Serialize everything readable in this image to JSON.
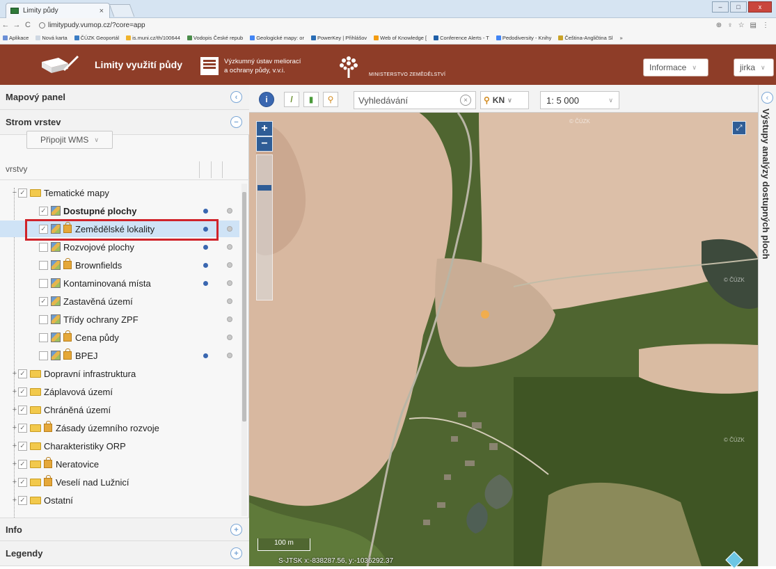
{
  "browser": {
    "tab_title": "Limity půdy",
    "tab_close": "×",
    "url": "limitypudy.vumop.cz/?core=app",
    "window_buttons": [
      "–",
      "□",
      "x"
    ],
    "nav": [
      "←",
      "→",
      "C"
    ],
    "addr_icons": [
      "⊕",
      "♀",
      "☆",
      "▤",
      "⋮"
    ],
    "bookmarks": [
      {
        "label": "Aplikace",
        "color": "#6b8fd6"
      },
      {
        "label": "Nová karta",
        "color": "#cfd8e3"
      },
      {
        "label": "ČÚZK Geoportál",
        "color": "#3c7dc4"
      },
      {
        "label": "is.muni.cz/th/100644",
        "color": "#f0b32c"
      },
      {
        "label": "Vodopis České repub",
        "color": "#4a8c4a"
      },
      {
        "label": "Geologické mapy: or",
        "color": "#4285f4"
      },
      {
        "label": "PowerKey | Přihlášov",
        "color": "#2a6db5"
      },
      {
        "label": "Web of Knowledge [",
        "color": "#f39c12"
      },
      {
        "label": "Conference Alerts - T",
        "color": "#1f5fa8"
      },
      {
        "label": "Pedodiversity - Knihy",
        "color": "#4285f4"
      },
      {
        "label": "Čeština-Angličtina Sl",
        "color": "#c9a227"
      },
      {
        "label": "»",
        "color": "#f6f6f6"
      }
    ]
  },
  "header": {
    "app_title": "Limity využití půdy",
    "vumop_line1": "Výzkumný ústav meliorací",
    "vumop_line2": "a ochrany půdy, v.v.i.",
    "ministry": "MINISTERSTVO ZEMĚDĚLSTVÍ",
    "info_select": "Informace",
    "user_select": "jirka",
    "brand_color": "#8e3d28"
  },
  "left_panel": {
    "map_panel_title": "Mapový panel",
    "layer_tree_title": "Strom vrstev",
    "wms_button": "Připojit WMS",
    "layers_label": "vrstvy",
    "info_title": "Info",
    "legend_title": "Legendy",
    "collapse_symbol": "‹",
    "minus_symbol": "−",
    "plus_symbol": "+"
  },
  "tree": [
    {
      "label": "Tematické mapy",
      "type": "folder",
      "expander": "−",
      "checked": true,
      "bold": false,
      "lock": false,
      "info": false,
      "depth": 0
    },
    {
      "label": "Dostupné plochy",
      "type": "layer",
      "checked": true,
      "bold": true,
      "lock": false,
      "info": true,
      "depth": 1
    },
    {
      "label": "Zemědělské lokality",
      "type": "layer",
      "checked": true,
      "bold": false,
      "lock": true,
      "info": true,
      "depth": 1,
      "selected": true
    },
    {
      "label": "Rozvojové plochy",
      "type": "layer",
      "checked": false,
      "bold": false,
      "lock": false,
      "info": true,
      "depth": 1
    },
    {
      "label": "Brownfields",
      "type": "layer",
      "checked": false,
      "bold": false,
      "lock": true,
      "info": true,
      "depth": 1
    },
    {
      "label": "Kontaminovaná místa",
      "type": "layer",
      "checked": false,
      "bold": false,
      "lock": false,
      "info": true,
      "depth": 1
    },
    {
      "label": "Zastavěná území",
      "type": "layer",
      "checked": true,
      "bold": false,
      "lock": false,
      "info": false,
      "depth": 1
    },
    {
      "label": "Třídy ochrany ZPF",
      "type": "layer",
      "checked": false,
      "bold": false,
      "lock": false,
      "info": false,
      "depth": 1
    },
    {
      "label": "Cena půdy",
      "type": "layer",
      "checked": false,
      "bold": false,
      "lock": true,
      "info": false,
      "depth": 1
    },
    {
      "label": "BPEJ",
      "type": "layer",
      "checked": false,
      "bold": false,
      "lock": true,
      "info": true,
      "depth": 1
    },
    {
      "label": "Dopravní infrastruktura",
      "type": "folder",
      "expander": "+",
      "checked": true,
      "bold": false,
      "lock": false,
      "info": false,
      "depth": 0
    },
    {
      "label": "Záplavová území",
      "type": "folder",
      "expander": "+",
      "checked": true,
      "bold": false,
      "lock": false,
      "info": false,
      "depth": 0
    },
    {
      "label": "Chráněná území",
      "type": "folder",
      "expander": "+",
      "checked": true,
      "bold": false,
      "lock": false,
      "info": false,
      "depth": 0
    },
    {
      "label": "Zásady územního rozvoje",
      "type": "folder",
      "expander": "+",
      "checked": true,
      "bold": false,
      "lock": true,
      "info": false,
      "depth": 0
    },
    {
      "label": "Charakteristiky ORP",
      "type": "folder",
      "expander": "+",
      "checked": true,
      "bold": false,
      "lock": false,
      "info": false,
      "depth": 0
    },
    {
      "label": "Neratovice",
      "type": "folder",
      "expander": "+",
      "checked": true,
      "bold": false,
      "lock": true,
      "info": false,
      "depth": 0
    },
    {
      "label": "Veselí nad Lužnicí",
      "type": "folder",
      "expander": "+",
      "checked": true,
      "bold": false,
      "lock": true,
      "info": false,
      "depth": 0
    },
    {
      "label": "Ostatní",
      "type": "folder",
      "expander": "+",
      "checked": true,
      "bold": false,
      "lock": false,
      "info": false,
      "depth": 0
    }
  ],
  "map": {
    "search_placeholder": "Vyhledávání",
    "kn_label": "KN",
    "scale_value": "1: 5 000",
    "zoom_in": "+",
    "zoom_out": "−",
    "fullscreen": "⤢",
    "scalebar": "100 m",
    "coords": "S-JTSK x:-838287.56, y:-1036292.37",
    "watermark": "© ČÚZK",
    "tool_info": "i",
    "tool_measure": "/",
    "tool_print": "▮",
    "tool_zoom": "⚲",
    "clear": "×"
  },
  "right_panel": {
    "title": "Výstupy analýzy dostupných ploch",
    "collapse_symbol": "‹"
  }
}
